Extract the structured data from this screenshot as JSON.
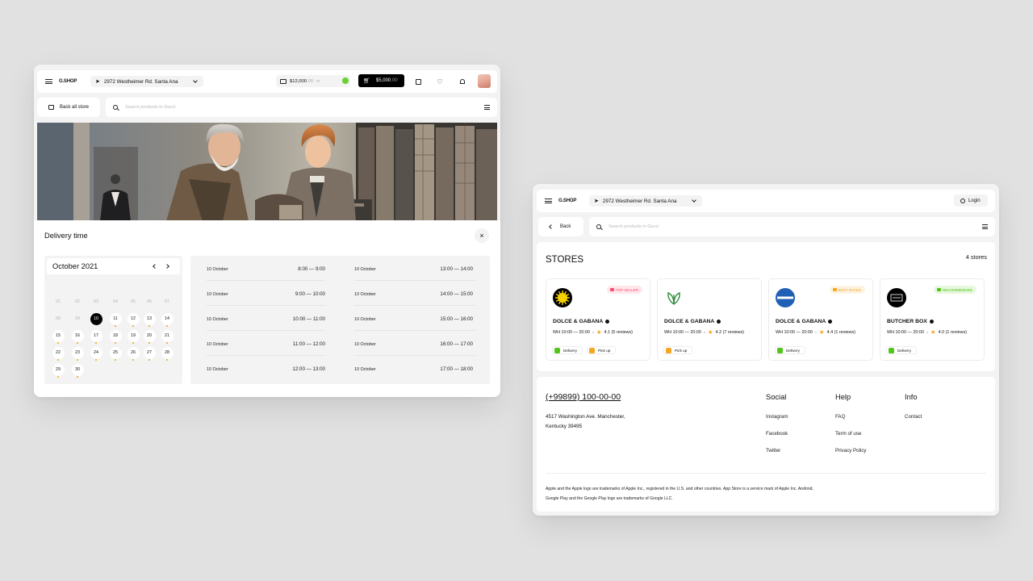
{
  "left": {
    "header": {
      "logo": "G.SHOP",
      "address": "2972 Westheimer Rd. Santa Ana",
      "balance_main": "$12,000",
      "balance_cents": ".00",
      "cart_main": "$5,000",
      "cart_cents": ".00"
    },
    "back_label": "Back all store",
    "search_placeholder": "Search products in Gucci",
    "panel": {
      "title": "Delivery time",
      "month": "October 2021",
      "weekdays": [
        "Mon",
        "Tue",
        "Wed",
        "Thu",
        "Fri",
        "Sat",
        "Sun"
      ],
      "days": [
        "01",
        "02",
        "03",
        "04",
        "05",
        "06",
        "07",
        "08",
        "09",
        "10",
        "11",
        "12",
        "13",
        "14",
        "15",
        "16",
        "17",
        "18",
        "19",
        "20",
        "21",
        "22",
        "23",
        "24",
        "25",
        "26",
        "27",
        "28",
        "29",
        "30"
      ],
      "selected_day": "10",
      "slots_left": [
        {
          "date": "10 October",
          "time": "8:00 — 9:00"
        },
        {
          "date": "10 October",
          "time": "9:00 — 10:00"
        },
        {
          "date": "10 October",
          "time": "10:00 — 11:00"
        },
        {
          "date": "10 October",
          "time": "11:00 — 12:00"
        },
        {
          "date": "10 October",
          "time": "12:00 — 13:00"
        }
      ],
      "slots_right": [
        {
          "date": "10 October",
          "time": "13:00 — 14:00"
        },
        {
          "date": "10 October",
          "time": "14:00 — 15:00"
        },
        {
          "date": "10 October",
          "time": "15:00 — 16:00"
        },
        {
          "date": "10 October",
          "time": "16:00 — 17:00"
        },
        {
          "date": "10 October",
          "time": "17:00 — 18:00"
        }
      ]
    }
  },
  "right": {
    "header": {
      "logo": "G.SHOP",
      "address": "2972 Westheimer Rd. Santa Ana",
      "login": "Login"
    },
    "back_label": "Back",
    "search_placeholder": "Search products in Gucci",
    "stores_title": "STORES",
    "stores_count": "4 stores",
    "stores": [
      {
        "name": "DOLCE & GABANA",
        "hours": "WH 10:00 — 20:00",
        "rating": "4.1 (5 reviews)",
        "badge": "TOP SELLER",
        "badge_color": "#ff4d6d",
        "logo_color": "#111111",
        "tags": [
          "Delivery",
          "Pick up"
        ]
      },
      {
        "name": "DOLCE & GABANA",
        "hours": "WH 10:00 — 20:00",
        "rating": "4.2 (7 reviews)",
        "badge": "",
        "badge_color": "",
        "logo_color": "#2e8b3d",
        "tags": [
          "Pick up"
        ]
      },
      {
        "name": "DOLCE & GABANA",
        "hours": "WH 10:00 — 20:00",
        "rating": "4.4 (1 reviews)",
        "badge": "BEST RATED",
        "badge_color": "#f5a623",
        "logo_color": "#1f5fb4",
        "tags": [
          "Delivery"
        ]
      },
      {
        "name": "BUTCHER BOX",
        "hours": "WH 10:00 — 20:00",
        "rating": "4.0 (1 reviews)",
        "badge": "RECOMMENDED",
        "badge_color": "#52c41a",
        "logo_color": "#000000",
        "tags": [
          "Delivery"
        ]
      }
    ],
    "footer": {
      "phone": "(+99899) 100-00-00",
      "address_line1": "4517 Washington Ave. Manchester,",
      "address_line2": "Kentucky 39495",
      "social_title": "Social",
      "social": [
        "Instagram",
        "Facebook",
        "Twitter"
      ],
      "help_title": "Help",
      "help": [
        "FAQ",
        "Term of use",
        "Privacy Policy"
      ],
      "info_title": "Info",
      "info": [
        "Contact"
      ],
      "legal_line1": "Apple and the Apple logo are trademarks of Apple Inc., registered in the U.S. and other countries. App Store is a service mark of Apple Inc. Android,",
      "legal_line2": "Google Play and the Google Play logo are trademarks of Google LLC."
    }
  }
}
